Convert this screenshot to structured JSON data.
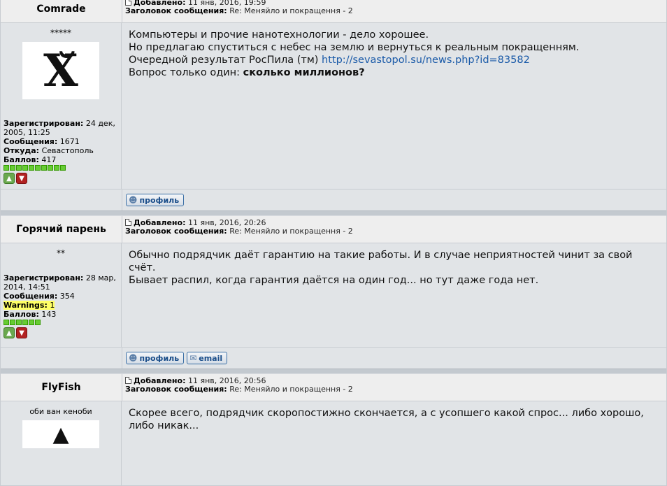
{
  "labels": {
    "added": "Добавлено:",
    "subject": "Заголовок сообщения:",
    "registered": "Зарегистрирован:",
    "posts": "Сообщения:",
    "from": "Откуда:",
    "points": "Баллов:",
    "warnings": "Warnings:",
    "profile_btn": "профиль",
    "email_btn": "email"
  },
  "posts": [
    {
      "author": "Comrade",
      "date": "11 янв, 2016, 19:59",
      "subject": "Re: Меняйло и покращення - 2",
      "rank": "*****",
      "avatar_text": "Х̆",
      "registered": "24 дек, 2005, 11:25",
      "posts": "1671",
      "from": "Севастополь",
      "points": "417",
      "pip_count": 10,
      "lines": [
        "Компьютеры и прочие нанотехнологии - дело хорошее.",
        "Но предлагаю спуститься с небес на землю и вернуться к реальным покращенням.",
        "Очередной результат РосПила (тм) "
      ],
      "link": "http://sevastopol.su/news.php?id=83582",
      "last_line_prefix": "Вопрос только один: ",
      "last_line_bold": "сколько миллионов?"
    },
    {
      "author": "Горячий парень",
      "date": "11 янв, 2016, 20:26",
      "subject": "Re: Меняйло и покращення - 2",
      "rank": "**",
      "registered": "28 мар, 2014, 14:51",
      "posts": "354",
      "warnings": "1",
      "points": "143",
      "pip_count": 6,
      "lines": [
        "Обычно подрядчик даёт гарантию на такие работы. И в случае неприятностей чинит за свой счёт.",
        "Бывает распил, когда гарантия даётся на один год... но тут даже года нет."
      ]
    },
    {
      "author": "FlyFish",
      "date": "11 янв, 2016, 20:56",
      "subject": "Re: Меняйло и покращення - 2",
      "rank": "оби ван кеноби",
      "lines": [
        "Скорее всего, подрядчик скоропостижно скончается, а с усопшего какой спрос... либо хорошо,",
        "либо никак..."
      ]
    }
  ]
}
